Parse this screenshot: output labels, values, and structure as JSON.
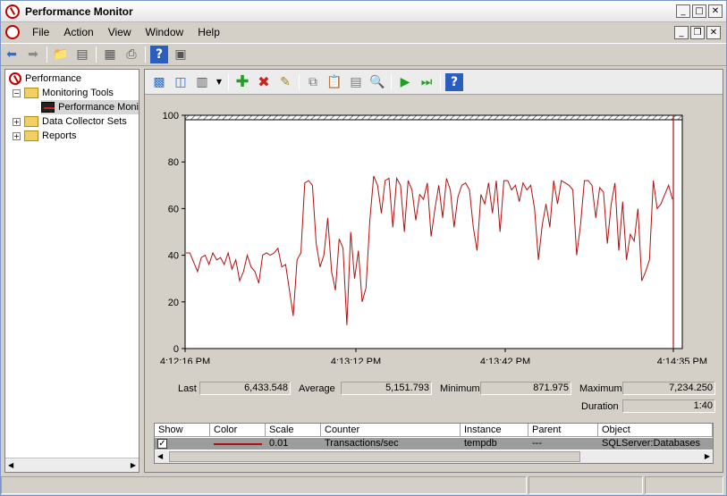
{
  "window": {
    "title": "Performance Monitor"
  },
  "menu": [
    "File",
    "Action",
    "View",
    "Window",
    "Help"
  ],
  "tree": {
    "root": "Performance",
    "monitoring_tools": "Monitoring Tools",
    "perf_monitor": "Performance Moni",
    "data_collector": "Data Collector Sets",
    "reports": "Reports"
  },
  "chart_data": {
    "type": "line",
    "x_ticks": [
      "4:12:16 PM",
      "4:13:12 PM",
      "4:13:42 PM",
      "4:14:35 PM"
    ],
    "y_ticks": [
      "100",
      "80",
      "60",
      "40",
      "20",
      "0"
    ],
    "ylim": [
      0,
      100
    ],
    "series": [
      {
        "color": "#b01010",
        "values": [
          41,
          41,
          37,
          33,
          39,
          40,
          36,
          41,
          38,
          39,
          36,
          41,
          34,
          38,
          29,
          33,
          40,
          35,
          33,
          28,
          40,
          41,
          40,
          41,
          43,
          35,
          36,
          25,
          14,
          38,
          41,
          71,
          72,
          70,
          45,
          35,
          40,
          56,
          33,
          25,
          47,
          43,
          10,
          50,
          30,
          42,
          20,
          26,
          55,
          74,
          70,
          58,
          72,
          73,
          52,
          73,
          70,
          50,
          72,
          68,
          55,
          66,
          64,
          71,
          48,
          60,
          70,
          56,
          73,
          68,
          52,
          65,
          70,
          71,
          68,
          52,
          42,
          66,
          62,
          71,
          58,
          72,
          50,
          72,
          72,
          68,
          70,
          63,
          71,
          68,
          70,
          60,
          38,
          53,
          62,
          52,
          72,
          62,
          72,
          71,
          70,
          68,
          40,
          53,
          72,
          72,
          70,
          56,
          69,
          67,
          45,
          62,
          71,
          42,
          63,
          38,
          49,
          46,
          60,
          29,
          33,
          38,
          72,
          60,
          62,
          66,
          70,
          64
        ]
      }
    ]
  },
  "stats": {
    "last_label": "Last",
    "last": "6,433.548",
    "avg_label": "Average",
    "avg": "5,151.793",
    "min_label": "Minimum",
    "min": "871.975",
    "max_label": "Maximum",
    "max": "7,234.250",
    "dur_label": "Duration",
    "dur": "1:40"
  },
  "counters": {
    "headers": [
      "Show",
      "Color",
      "Scale",
      "Counter",
      "Instance",
      "Parent",
      "Object"
    ],
    "row": {
      "scale": "0.01",
      "counter": "Transactions/sec",
      "instance": "tempdb",
      "parent": "---",
      "object": "SQLServer:Databases"
    }
  }
}
